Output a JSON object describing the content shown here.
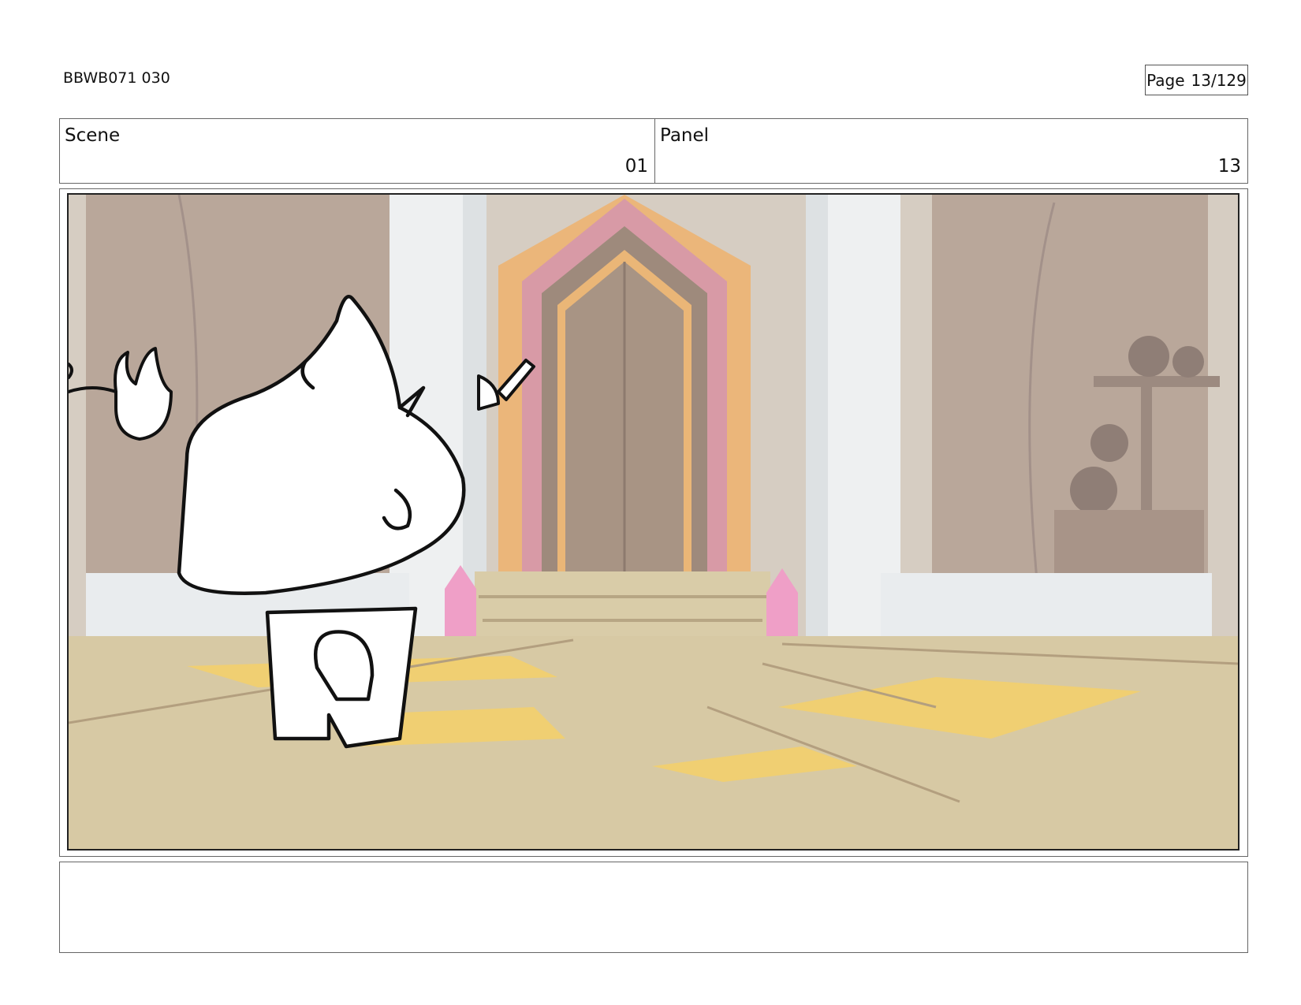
{
  "header": {
    "doc_code": "BBWB071 030",
    "page_label": "Page",
    "page_number": "13/129"
  },
  "info": {
    "scene_label": "Scene",
    "scene_value": "01",
    "panel_label": "Panel",
    "panel_value": "13"
  },
  "colors": {
    "floor": "#d7c9a4",
    "floor_highlight": "#f0cf72",
    "wall": "#bfae9e",
    "pillar": "#eef0f1",
    "door": "#a89484",
    "door_frame_pink": "#d79aa5",
    "door_frame_orange": "#eab677",
    "crystal": "#ef9fc7",
    "ink": "#111111"
  }
}
